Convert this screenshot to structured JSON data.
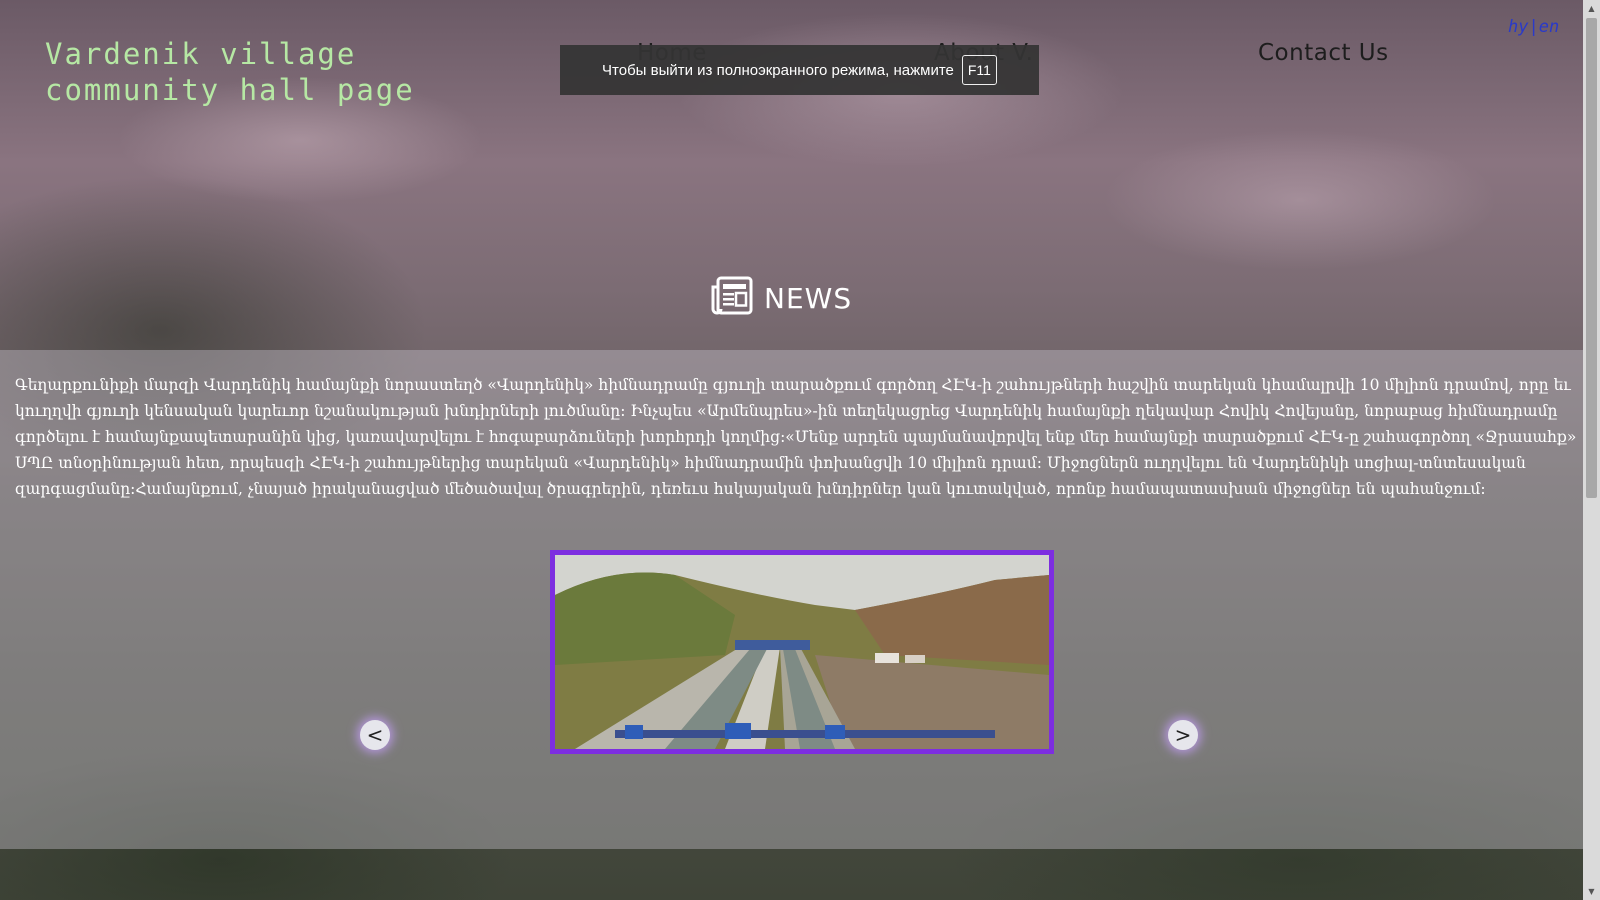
{
  "site": {
    "title": "Vardenik village community hall page"
  },
  "nav": {
    "home": "Home",
    "about": "About V.",
    "contact": "Contact Us"
  },
  "lang_switch": "hy|en",
  "fullscreen_notice": {
    "text": "Чтобы выйти из полноэкранного режима, нажмите",
    "key": "F11"
  },
  "news": {
    "heading": "NEWS",
    "icon": "newspaper-icon",
    "article": "Գեղարքունիքի մարզի Վարդենիկ համայնքի նորաստեղծ «Վարդենիկ» հիմնադրամը գյուղի տարածքում գործող ՀԷԿ-ի շահույթների հաշվին տարեկան կհամալրվի 10 միլիոն դրամով, որը եւ կուղղվի գյուղի կենսական կարեւոր նշանակության խնդիրների լուծմանը: Ինչպես «Արմենպրես»-ին տեղեկացրեց Վարդենիկ համայնքի ղեկավար Հովիկ Հովեյանը, նորաբաց հիմնադրամը գործելու է համայնքապետարանին կից, կառավարվելու է հոգաբարձուների խորհրդի կողմից:«Մենք արդեն պայմանավորվել ենք մեր համայնքի տարածքում ՀԷԿ-ը շահագործող «Ջրասահք» ՍՊԸ տնօրինության հետ, որպեսզի ՀԷԿ-ի շահույթներից տարեկան «Վարդենիկ» հիմնադրամին փոխանցվի 10 միլիոն դրամ: Միջոցներն ուղղվելու են Վարդենիկի սոցիալ-տնտեսական զարգացմանը:Համայնքում, չնայած իրականացված մեծածավալ ծրագրերին, դեռեւս հսկայական խնդիրներ կան կուտակված, որոնք համապատասխան միջոցներ են պահանջում:"
  },
  "slider": {
    "prev_label": "<",
    "next_label": ">"
  },
  "colors": {
    "title_green": "#b6e8a4",
    "frame_purple": "#7d2ee0",
    "lang_blue": "#2a3ac8"
  }
}
